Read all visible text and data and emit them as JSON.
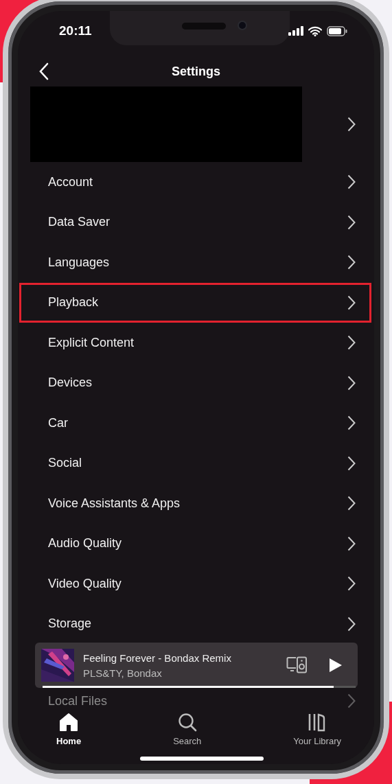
{
  "status_bar": {
    "time": "20:11"
  },
  "header": {
    "title": "Settings"
  },
  "items": [
    {
      "kind": "redacted",
      "highlighted": false,
      "faded": false
    },
    {
      "kind": "link",
      "label": "Account",
      "highlighted": false,
      "faded": false
    },
    {
      "kind": "link",
      "label": "Data Saver",
      "highlighted": false,
      "faded": false
    },
    {
      "kind": "link",
      "label": "Languages",
      "highlighted": false,
      "faded": false
    },
    {
      "kind": "link",
      "label": "Playback",
      "highlighted": true,
      "faded": false
    },
    {
      "kind": "link",
      "label": "Explicit Content",
      "highlighted": false,
      "faded": false
    },
    {
      "kind": "link",
      "label": "Devices",
      "highlighted": false,
      "faded": false
    },
    {
      "kind": "link",
      "label": "Car",
      "highlighted": false,
      "faded": false
    },
    {
      "kind": "link",
      "label": "Social",
      "highlighted": false,
      "faded": false
    },
    {
      "kind": "link",
      "label": "Voice Assistants & Apps",
      "highlighted": false,
      "faded": false
    },
    {
      "kind": "link",
      "label": "Audio Quality",
      "highlighted": false,
      "faded": false
    },
    {
      "kind": "link",
      "label": "Video Quality",
      "highlighted": false,
      "faded": false
    },
    {
      "kind": "link",
      "label": "Storage",
      "highlighted": false,
      "faded": false
    },
    {
      "kind": "link",
      "label": "Local Files",
      "highlighted": false,
      "faded": true
    }
  ],
  "now_playing": {
    "title": "Feeling Forever - Bondax Remix",
    "artist": "PLS&TY, Bondax",
    "level": 0.93
  },
  "nav": [
    {
      "kind": "home",
      "label": "Home",
      "selected": true
    },
    {
      "kind": "search",
      "label": "Search",
      "selected": false
    },
    {
      "kind": "library",
      "label": "Your Library",
      "selected": false
    }
  ]
}
